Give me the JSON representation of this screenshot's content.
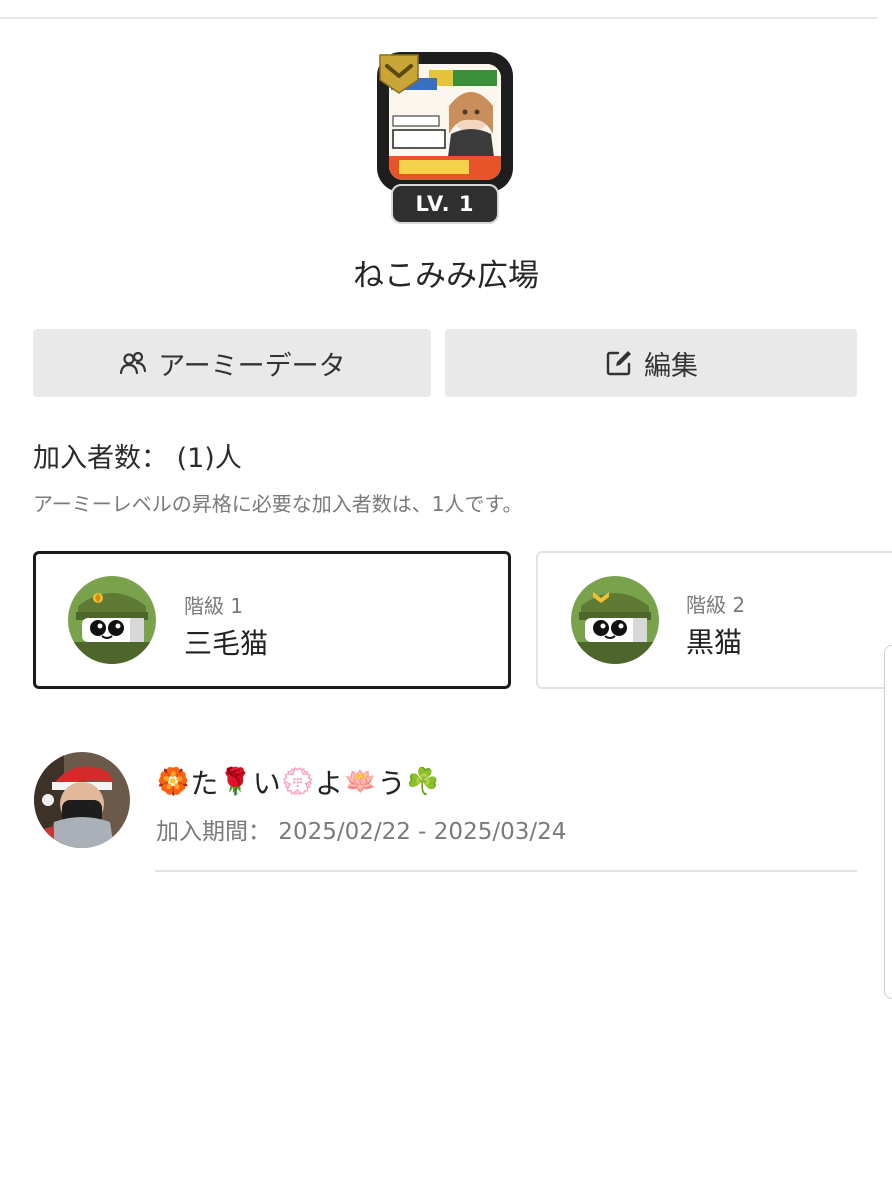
{
  "army": {
    "name": "ねこみみ広場",
    "level": "LV. 1",
    "avatar_icon": "army-thumbnail-image",
    "rank_icon": "chevron-rank-icon"
  },
  "actions": {
    "army_data_label": "アーミーデータ",
    "army_data_icon": "people-icon",
    "edit_label": "編集",
    "edit_icon": "edit-icon"
  },
  "members": {
    "count_label": "加入者数： (1)人",
    "note": "アーミーレベルの昇格に必要な加入者数は、1人です。"
  },
  "ranks": [
    {
      "level": "階級 1",
      "name": "三毛猫",
      "selected": true
    },
    {
      "level": "階級 2",
      "name": "黒猫",
      "selected": false
    }
  ],
  "member_list": [
    {
      "name_parts": [
        "🏵️",
        "た",
        "🌹",
        "い",
        "💮",
        "よ",
        "🪷",
        "う",
        "☘️"
      ],
      "period": "加入期間： 2025/02/22 - 2025/03/24"
    }
  ],
  "colors": {
    "button_bg": "#e9e9e9",
    "selected_border": "#1b1b1b",
    "cat_green": "#6f8f45",
    "badge_bg": "#2f2f2f",
    "chevron_gold": "#c9a437"
  }
}
